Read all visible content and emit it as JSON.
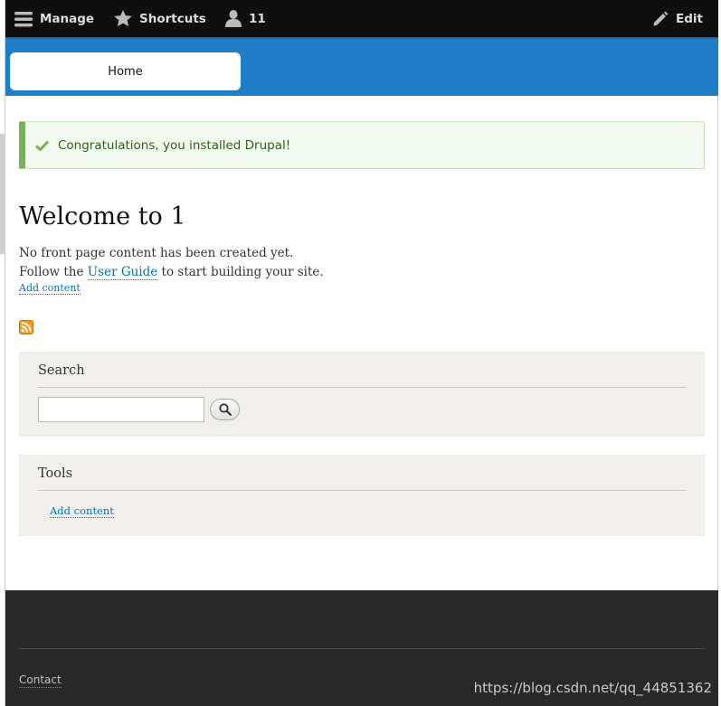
{
  "toolbar": {
    "manage_label": "Manage",
    "shortcuts_label": "Shortcuts",
    "user_label": "11",
    "edit_label": "Edit"
  },
  "header": {
    "home_tab": "Home"
  },
  "status": {
    "message": "Congratulations, you installed Drupal!"
  },
  "main": {
    "title": "Welcome to 1",
    "line1": "No front page content has been created yet.",
    "line2_prefix": "Follow the ",
    "line2_link": "User Guide",
    "line2_suffix": " to start building your site.",
    "add_content": "Add content"
  },
  "search_block": {
    "title": "Search",
    "input_value": ""
  },
  "tools_block": {
    "title": "Tools",
    "link": "Add content"
  },
  "footer": {
    "contact": "Contact"
  },
  "watermark": "https://blog.csdn.net/qq_44851362",
  "colors": {
    "toolbar": "#0f0f0f",
    "header": "#1f7ec5",
    "status_bg": "#f2f9ef",
    "status_accent": "#77b259",
    "link": "#0071b3",
    "block_bg": "#f0efeb",
    "footer": "#292929"
  }
}
